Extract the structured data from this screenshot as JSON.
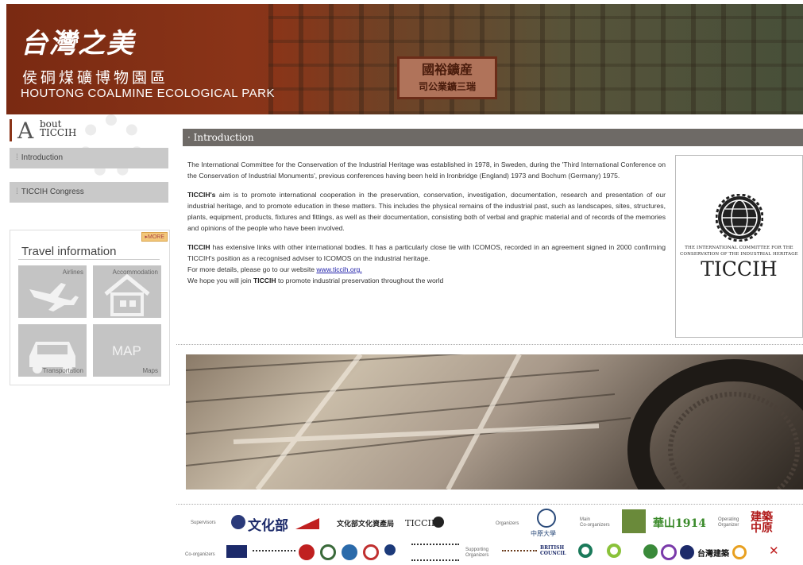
{
  "banner": {
    "logo_cn": "台灣之美",
    "park_cn": "侯硐煤礦博物園區",
    "park_en": "HOUTONG COALMINE ECOLOGICAL PARK",
    "sign_line1": "國裕鑛産",
    "sign_line2": "司公業鑛三瑞"
  },
  "sidebar": {
    "about_big": "A",
    "about_small_1": "bout",
    "about_small_2": "TICCIH",
    "items": [
      {
        "label": "Introduction"
      },
      {
        "label": "TICCIH Congress"
      }
    ],
    "travel": {
      "more": "▸MORE",
      "title": "Travel information",
      "tiles": [
        {
          "label": "Airlines",
          "icon": "airplane-icon"
        },
        {
          "label": "Accommodation",
          "icon": "house-icon"
        },
        {
          "label": "Transportation",
          "icon": "car-icon"
        },
        {
          "label": "Maps",
          "icon": "map-icon",
          "overlay": "MAP"
        }
      ]
    }
  },
  "main": {
    "heading": "· Introduction",
    "para1": "The International Committee for the Conservation of the Industrial Heritage was established in 1978, in Sweden, during the 'Third International Conference on the Conservation of Industrial Monuments', previous conferences having been held in Ironbridge (England) 1973 and Bochum (Germany) 1975.",
    "para2_bold": "TICCIH's",
    "para2": " aim is to promote international cooperation in the preservation, conservation, investigation, documentation, research and presentation of our industrial heritage, and to promote education in these matters. This includes the physical remains of the industrial past, such as landscapes, sites, structures, plants, equipment, products, fixtures and fittings, as well as their documentation, consisting both of verbal and graphic material and of records of the memories and opinions of the people who have been involved.",
    "para3_bold": "TICCIH",
    "para3": " has extensive links with other international bodies.  It has a particularly close tie with ICOMOS, recorded in an agreement signed in 2000 confirming TICCIH's position as a recognised adviser to ICOMOS on the industrial heritage.",
    "para3_line2": "For more details, please go to our website ",
    "website": "www.ticcih.org.",
    "para3_line3a": "We hope you will join ",
    "para3_line3b": "TICCIH",
    "para3_line3c": " to promote industrial preservation throughout the world",
    "ticcih_caption_1": "The International Committee for the",
    "ticcih_caption_2": "Conservation of the Industrial Heritage",
    "ticcih_brand": "TICCIH"
  },
  "sponsors": {
    "supervisors_label": "Supervisors",
    "moc": "文化部",
    "boch": "文化部文化資產局",
    "ticcih": "TICCIH",
    "organizers_label": "Organizers",
    "cycu": "中原大學",
    "main_co_label_1": "Main",
    "main_co_label_2": "Co-organizers",
    "huashan": "華山1914",
    "operating_label_1": "Operating",
    "operating_label_2": "Organizer",
    "operating_org": "建築中原",
    "co_organizers_label": "Co-organizers",
    "supporting_label_1": "Supporting",
    "supporting_label_2": "Organizers",
    "british_council": "BRITISH COUNCIL",
    "taiwan_arch": "台灣建築"
  },
  "colors": {
    "banner_brown": "#8a3418",
    "heading_bar": "#6e6a66",
    "nav_gray": "#c9c9c9",
    "link_blue": "#2222aa"
  }
}
